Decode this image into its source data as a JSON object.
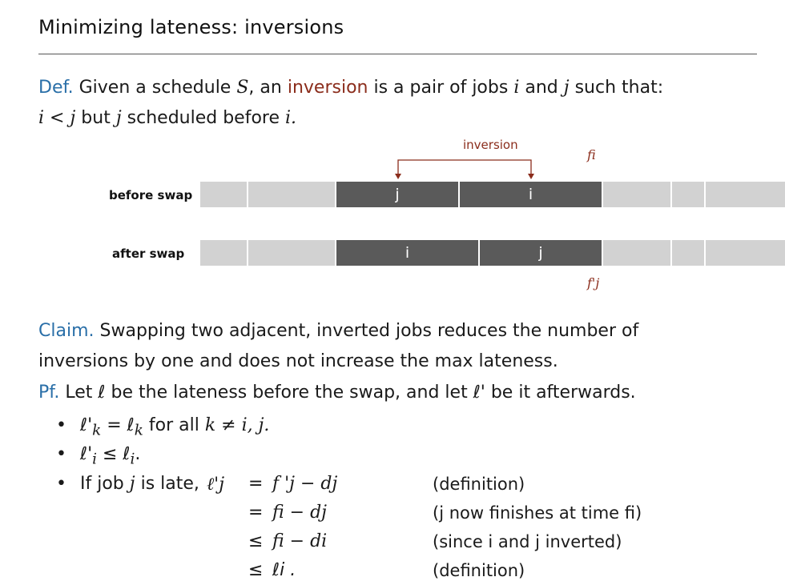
{
  "slide": {
    "title": "Minimizing lateness: inversions",
    "def": {
      "keyword": "Def.",
      "t1": "Given a schedule",
      "S": "S",
      "t2": ", an",
      "inversion": "inversion",
      "t3": "is a pair of jobs",
      "i": "i",
      "and": "and",
      "j": "j",
      "t4": "such that:",
      "line2_a": "i < j",
      "line2_but": "but",
      "line2_j": "j",
      "line2_b": "scheduled before",
      "line2_i": "i."
    },
    "diagram": {
      "inversion_label": "inversion",
      "fi": "fi",
      "fpj": "f'j",
      "before_label": "before swap",
      "after_label": "after swap",
      "before_jobs": [
        "j",
        "i"
      ],
      "after_jobs": [
        "i",
        "j"
      ]
    },
    "claim": {
      "keyword": "Claim.",
      "line1": "Swapping two adjacent, inverted jobs reduces the number of",
      "line2": "inversions by one and does not increase the max lateness."
    },
    "proof": {
      "keyword": "Pf.",
      "t1": "Let ℓ be the lateness before the swap, and let",
      "t2": "ℓ'",
      "t3": "be it afterwards.",
      "b1_a": "ℓ'",
      "b1_k": "k",
      "b1_b": "= ℓ",
      "b1_k2": "k",
      "b1_c": "for all",
      "b1_d": "k ≠ i, j.",
      "b2_a": "ℓ'",
      "b2_i": "i",
      "b2_b": "≤ ℓ",
      "b2_i2": "i",
      "b2_c": ".",
      "b3_a": "If job",
      "b3_j": "j",
      "b3_b": "is late,",
      "eq": [
        {
          "lhs": "ℓ'j",
          "op": "=",
          "rhs": "f 'j − dj",
          "note": "(definition)"
        },
        {
          "lhs": "",
          "op": "=",
          "rhs": "fi − dj",
          "note": "(j now finishes at time fi)"
        },
        {
          "lhs": "",
          "op": "≤",
          "rhs": "fi − di",
          "note": "(since i and j inverted)"
        },
        {
          "lhs": "",
          "op": "≤",
          "rhs": "ℓi .",
          "note": "(definition)"
        }
      ]
    }
  }
}
